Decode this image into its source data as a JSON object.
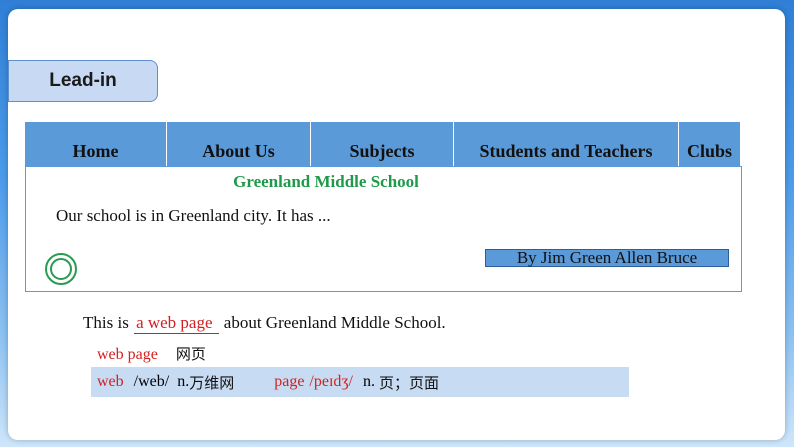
{
  "section_label": "Lead-in",
  "nav": {
    "items": [
      "Home",
      "About Us",
      "Subjects",
      "Students and Teachers",
      "Clubs"
    ]
  },
  "webpage": {
    "title": "Greenland Middle School",
    "intro": "Our school is in Greenland city. It has ...",
    "author": "By Jim Green  Allen Bruce"
  },
  "sentence": {
    "before": "This is",
    "answer": "a web page",
    "after": "about Greenland Middle School."
  },
  "vocab_line1": {
    "term": "web page",
    "meaning": "网页"
  },
  "vocab_line2": {
    "word1": "web",
    "phon1": "/web/",
    "pos1": "n.",
    "meaning1": "万维网",
    "word2": "page",
    "phon2": "/peɪdʒ/",
    "pos2": "n.",
    "meaning2": "页；页面"
  },
  "colors": {
    "nav_bg": "#5b9ad9",
    "title_green": "#1e9a4a",
    "answer_red": "#d42020",
    "vocab_strip": "#c7dcf3"
  }
}
